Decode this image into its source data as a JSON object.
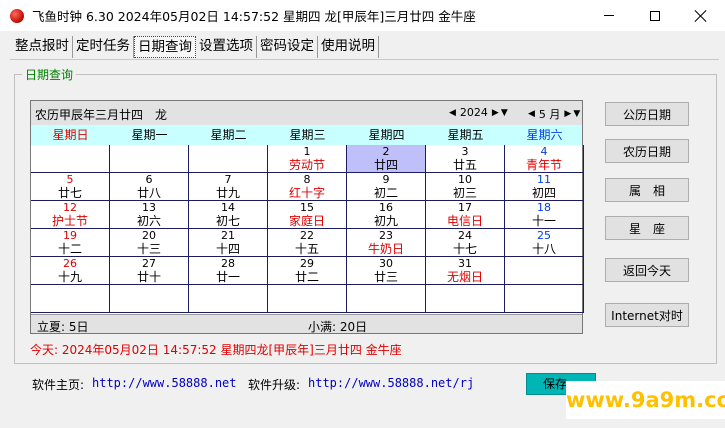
{
  "window": {
    "title": "飞鱼时钟 6.30 2024年05月02日 14:57:52 星期四 龙[甲辰年]三月廿四 金牛座"
  },
  "tabs": [
    {
      "label": "整点报时"
    },
    {
      "label": "定时任务"
    },
    {
      "label": "日期查询"
    },
    {
      "label": "设置选项"
    },
    {
      "label": "密码设定"
    },
    {
      "label": "使用说明"
    }
  ],
  "group": {
    "title": "日期查询"
  },
  "calendar": {
    "lunar_title": "农历甲辰年三月廿四　龙",
    "year": "2024",
    "month": "5 月",
    "weekdays": [
      "星期日",
      "星期一",
      "星期二",
      "星期三",
      "星期四",
      "星期五",
      "星期六"
    ],
    "colors": {
      "sunday": "#e00000",
      "saturday": "#0040e0",
      "weekday": "#000000",
      "festival": "#e00000"
    },
    "weeks": [
      [
        null,
        null,
        null,
        {
          "d": "1",
          "l": "劳动节",
          "fest": true
        },
        {
          "d": "2",
          "l": "廿四",
          "today": true
        },
        {
          "d": "3",
          "l": "廿五"
        },
        {
          "d": "4",
          "l": "青年节",
          "fest": true
        }
      ],
      [
        {
          "d": "5",
          "l": "廿七"
        },
        {
          "d": "6",
          "l": "廿八"
        },
        {
          "d": "7",
          "l": "廿九"
        },
        {
          "d": "8",
          "l": "红十字",
          "fest": true
        },
        {
          "d": "9",
          "l": "初二"
        },
        {
          "d": "10",
          "l": "初三"
        },
        {
          "d": "11",
          "l": "初四"
        }
      ],
      [
        {
          "d": "12",
          "l": "护士节",
          "fest": true
        },
        {
          "d": "13",
          "l": "初六"
        },
        {
          "d": "14",
          "l": "初七"
        },
        {
          "d": "15",
          "l": "家庭日",
          "fest": true
        },
        {
          "d": "16",
          "l": "初九"
        },
        {
          "d": "17",
          "l": "电信日",
          "fest": true
        },
        {
          "d": "18",
          "l": "十一"
        }
      ],
      [
        {
          "d": "19",
          "l": "十二"
        },
        {
          "d": "20",
          "l": "十三"
        },
        {
          "d": "21",
          "l": "十四"
        },
        {
          "d": "22",
          "l": "十五"
        },
        {
          "d": "23",
          "l": "牛奶日",
          "fest": true
        },
        {
          "d": "24",
          "l": "十七"
        },
        {
          "d": "25",
          "l": "十八"
        }
      ],
      [
        {
          "d": "26",
          "l": "十九"
        },
        {
          "d": "27",
          "l": "廿十"
        },
        {
          "d": "28",
          "l": "廿一"
        },
        {
          "d": "29",
          "l": "廿二"
        },
        {
          "d": "30",
          "l": "廿三"
        },
        {
          "d": "31",
          "l": "无烟日",
          "fest": true
        },
        null
      ],
      [
        null,
        null,
        null,
        null,
        null,
        null,
        null
      ]
    ],
    "terms": {
      "left": "立夏: 5日",
      "right": "小满: 20日"
    }
  },
  "side_buttons": [
    {
      "label": "公历日期"
    },
    {
      "label": "农历日期"
    },
    {
      "label": "属　相"
    },
    {
      "label": "星　座"
    },
    {
      "label": "返回今天"
    },
    {
      "label": "Internet对时"
    }
  ],
  "today_line": "今天: 2024年05月02日 14:57:52 星期四龙[甲辰年]三月廿四 金牛座",
  "footer": {
    "home_label": "软件主页:",
    "home_url": "http://www.58888.net",
    "upgrade_label": "软件升级:",
    "upgrade_url": "http://www.58888.net/rj",
    "save_label": "保存"
  },
  "watermark": "www.9a9m.com"
}
